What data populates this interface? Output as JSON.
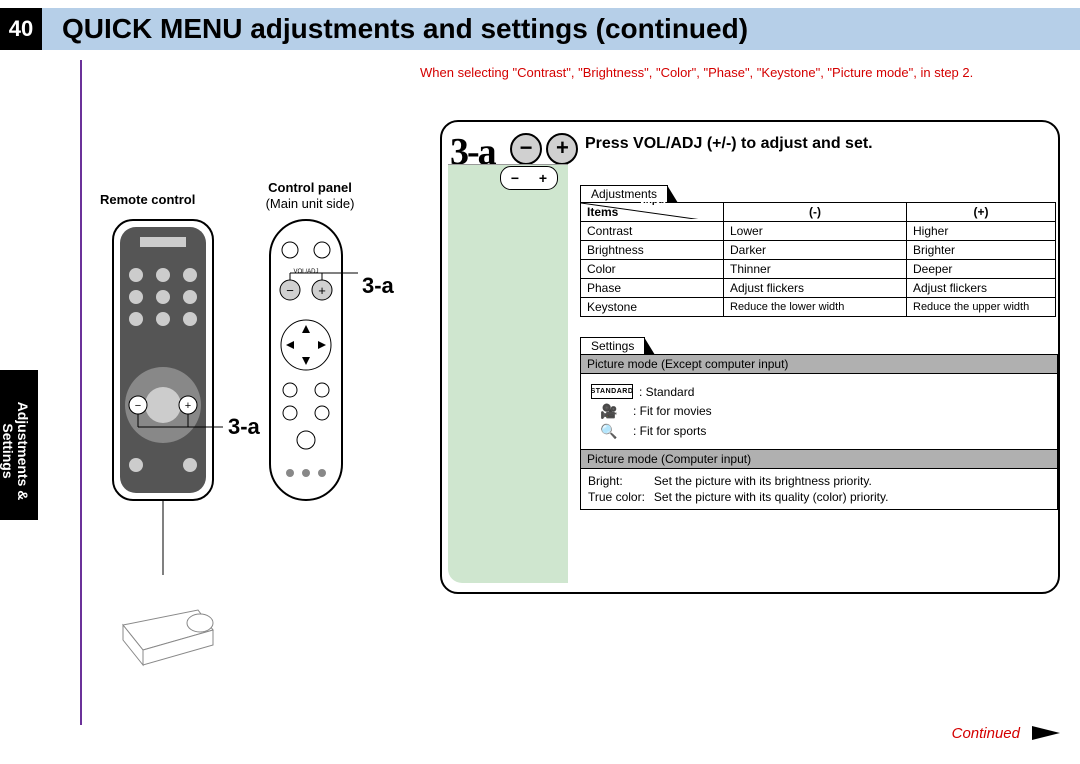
{
  "page_number": "40",
  "header_title": "QUICK MENU adjustments and settings (continued)",
  "side_tab": "Adjustments &\nSettings",
  "intro_text": "When selecting \"Contrast\", \"Brightness\", \"Color\", \"Phase\", \"Keystone\", \"Picture mode\", in step 2.",
  "labels": {
    "remote": "Remote control",
    "panel": "Control panel",
    "panel_sub": "(Main unit side)",
    "pointer_3a": "3-a",
    "step_badge": "3-a",
    "step_title": "Press VOL/ADJ (+/-) to adjust and set.",
    "adjustments_tab": "Adjustments",
    "settings_tab": "Settings",
    "continued": "Continued"
  },
  "adj_table": {
    "col_items": "Items",
    "col_inputs": "Inputs",
    "col_minus": "(-)",
    "col_plus": "(+)",
    "rows": [
      {
        "item": "Contrast",
        "minus": "Lower",
        "plus": "Higher"
      },
      {
        "item": "Brightness",
        "minus": "Darker",
        "plus": "Brighter"
      },
      {
        "item": "Color",
        "minus": "Thinner",
        "plus": "Deeper"
      },
      {
        "item": "Phase",
        "minus": "Adjust flickers",
        "plus": "Adjust flickers"
      },
      {
        "item": "Keystone",
        "minus": "Reduce the lower width",
        "plus": "Reduce the upper width"
      }
    ]
  },
  "settings": {
    "pm1_header": "Picture mode (Except computer input)",
    "pm1_rows": [
      {
        "icon": "STANDARD",
        "label": ": Standard"
      },
      {
        "icon": "movie",
        "label": ": Fit for movies"
      },
      {
        "icon": "sports",
        "label": ": Fit for sports"
      }
    ],
    "pm2_header": "Picture mode (Computer input)",
    "pm2_rows": [
      {
        "key": "Bright:",
        "desc": "Set the picture with its brightness priority."
      },
      {
        "key": "True color:",
        "desc": "Set the picture with its quality (color) priority."
      }
    ]
  }
}
